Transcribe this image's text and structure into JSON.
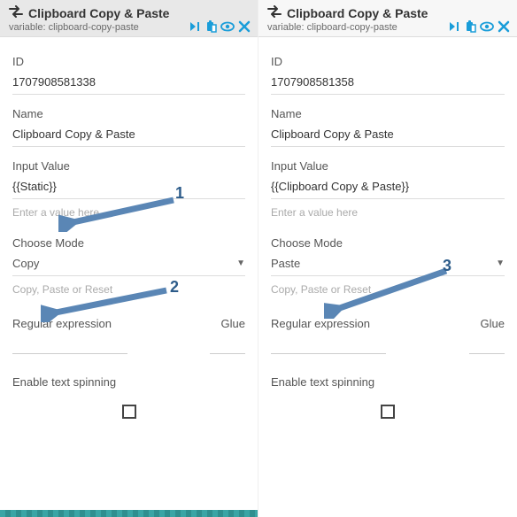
{
  "left": {
    "header": {
      "title": "Clipboard Copy & Paste",
      "variable_label": "variable:",
      "variable_value": "clipboard-copy-paste"
    },
    "id_label": "ID",
    "id_value": "1707908581338",
    "name_label": "Name",
    "name_value": "Clipboard Copy & Paste",
    "input_label": "Input Value",
    "input_value": "{{Static}}",
    "input_placeholder": "Enter a value here",
    "mode_label": "Choose Mode",
    "mode_value": "Copy",
    "mode_hint": "Copy, Paste or Reset",
    "regex_label": "Regular expression",
    "glue_label": "Glue",
    "spin_label": "Enable text spinning"
  },
  "right": {
    "header": {
      "title": "Clipboard Copy & Paste",
      "variable_label": "variable:",
      "variable_value": "clipboard-copy-paste"
    },
    "id_label": "ID",
    "id_value": "1707908581358",
    "name_label": "Name",
    "name_value": "Clipboard Copy & Paste",
    "input_label": "Input Value",
    "input_value": "{{Clipboard Copy & Paste}}",
    "input_placeholder": "Enter a value here",
    "mode_label": "Choose Mode",
    "mode_value": "Paste",
    "mode_hint": "Copy, Paste or Reset",
    "regex_label": "Regular expression",
    "glue_label": "Glue",
    "spin_label": "Enable text spinning"
  },
  "annotations": {
    "a1": "1",
    "a2": "2",
    "a3": "3"
  }
}
